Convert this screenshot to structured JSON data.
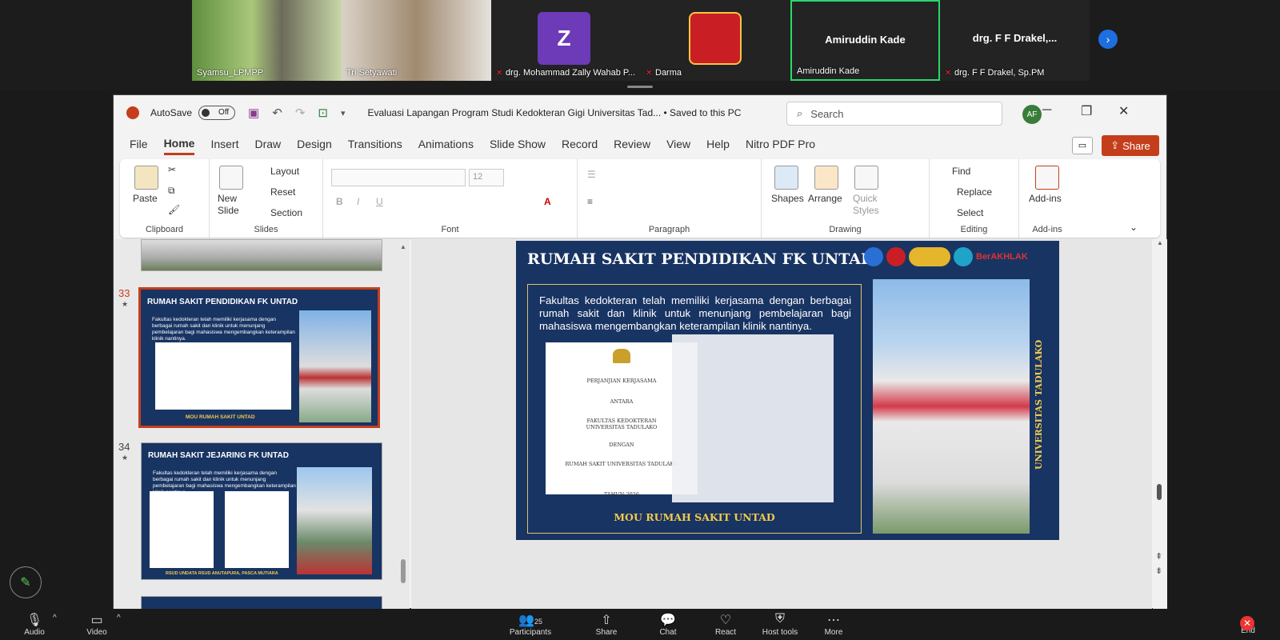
{
  "participants": [
    {
      "name": "Syamsu_LPMPP"
    },
    {
      "name": "Tri Setyawati"
    },
    {
      "name": "drg. Mohammad Zally Wahab P...",
      "avatar_letter": "Z"
    },
    {
      "name": "Darma"
    },
    {
      "name": "Amiruddin Kade",
      "center": "Amiruddin Kade"
    },
    {
      "name": "drg. F F Drakel, Sp.PM",
      "center": "drg. F F Drakel,..."
    }
  ],
  "titlebar": {
    "autosave": "AutoSave",
    "toggle": "Off",
    "doc_title": "Evaluasi Lapangan Program Studi Kedokteran Gigi Universitas Tad...  •  Saved to this PC",
    "search_placeholder": "Search",
    "account": "AF"
  },
  "tabs": [
    "File",
    "Home",
    "Insert",
    "Draw",
    "Design",
    "Transitions",
    "Animations",
    "Slide Show",
    "Record",
    "Review",
    "View",
    "Help",
    "Nitro PDF Pro"
  ],
  "share_label": "Share",
  "ribbon": {
    "clipboard": {
      "paste": "Paste",
      "label": "Clipboard"
    },
    "slides": {
      "new_slide": "New Slide",
      "layout": "Layout",
      "reset": "Reset",
      "section": "Section",
      "label": "Slides"
    },
    "font": {
      "size": "12",
      "label": "Font"
    },
    "paragraph": {
      "label": "Paragraph"
    },
    "drawing": {
      "shapes": "Shapes",
      "arrange": "Arrange",
      "quick_styles": "Quick Styles",
      "label": "Drawing"
    },
    "editing": {
      "find": "Find",
      "replace": "Replace",
      "select": "Select",
      "label": "Editing"
    },
    "addins": {
      "addins": "Add-ins",
      "label": "Add-ins"
    }
  },
  "thumbnails": [
    {
      "num": "33",
      "title": "RUMAH SAKIT PENDIDIKAN FK UNTAD",
      "text": "Fakultas kedokteran telah memiliki kerjasama dengan berbagai rumah sakit dan klinik untuk menunjang pembelajaran bagi mahasiswa mengembangkan keterampilan klinik nantinya.",
      "caption": "MOU RUMAH SAKIT UNTAD"
    },
    {
      "num": "34",
      "title": "RUMAH SAKIT JEJARING FK UNTAD",
      "text": "Fakultas kedokteran telah memiliki kerjasama dengan berbagai rumah sakit dan klinik untuk menunjang pembelajaran bagi mahasiswa mengembangkan keterampilan klinik nantinya.",
      "caption": "RSUD UNDATA          RSUD ANUTAPURA, PASCA MUTIARA"
    }
  ],
  "slide": {
    "title": "RUMAH SAKIT PENDIDIKAN FK UNTAD",
    "body": "Fakultas kedokteran telah memiliki kerjasama dengan berbagai rumah sakit dan klinik untuk menunjang pembelajaran bagi mahasiswa mengembangkan keterampilan klinik nantinya.",
    "doc_lines": [
      "PERJANJIAN KERJASAMA",
      "ANTARA",
      "FAKULTAS KEDOKTERAN UNIVERSITAS TADULAKO",
      "DENGAN",
      "RUMAH SAKIT UNIVERSITAS TADULAKO",
      "TAHUN 2026"
    ],
    "caption": "MOU RUMAH SAKIT UNTAD",
    "side_text": "UNIVERSITAS TADULAKO",
    "brand": "BerAKHLAK"
  },
  "zoom_bar": {
    "audio": "Audio",
    "video": "Video",
    "participants": "Participants",
    "participants_count": "25",
    "share": "Share",
    "chat": "Chat",
    "react": "React",
    "host_tools": "Host tools",
    "more": "More",
    "end": "End"
  },
  "colors": {
    "ppt_accent": "#c43e1c",
    "slide_navy": "#183463",
    "gold": "#f2c94c",
    "zoom_blue": "#1d6fe0"
  }
}
